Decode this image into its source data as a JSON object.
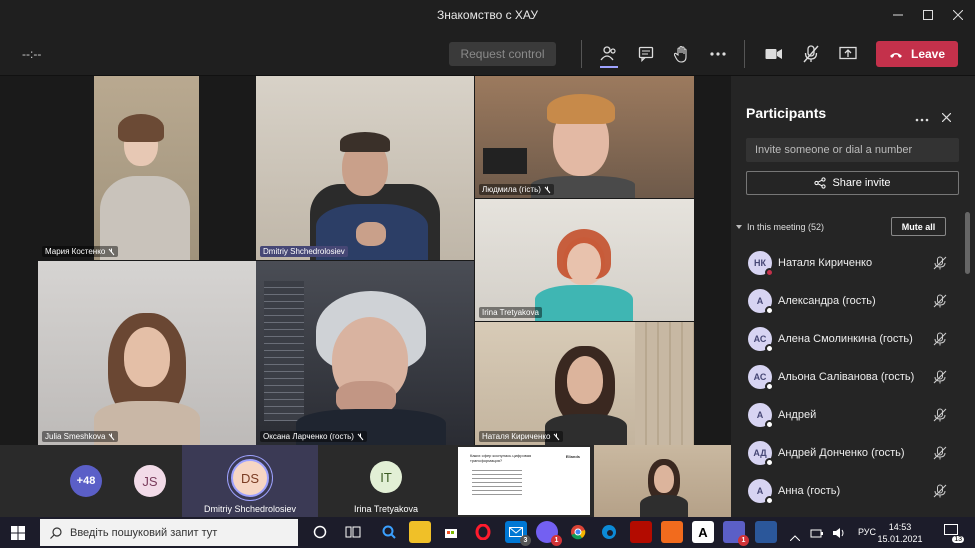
{
  "window": {
    "title": "Знакомство с ХАУ"
  },
  "toolbar": {
    "timer": "--:--",
    "request_control": "Request control",
    "leave_label": "Leave",
    "accent": "#c4314b"
  },
  "stage": {
    "tiles": [
      {
        "name": "Мария Костенко",
        "mic": "muted"
      },
      {
        "name": "Dmitriy Shchedrolosiev",
        "mic": "none"
      },
      {
        "name": "Людмила (гість)",
        "mic": "muted"
      },
      {
        "name": "Irina Tretyakova",
        "mic": "none"
      },
      {
        "name": "Julia Smeshkova",
        "mic": "muted"
      },
      {
        "name": "Оксана Ларченко (гость)",
        "mic": "muted"
      },
      {
        "name": "Наталя Кириченко",
        "mic": "muted"
      }
    ]
  },
  "strip": {
    "more_count": "+48",
    "items": [
      {
        "initials": "JS",
        "label": ""
      },
      {
        "initials": "DS",
        "label": "Dmitriy Shchedrolosiev"
      },
      {
        "initials": "IT",
        "label": "Irina Tretyakova"
      }
    ],
    "slide": {
      "title": "Каких сфер коснулась цифровая трансформация?",
      "brand": "Ellands"
    }
  },
  "participants": {
    "title": "Participants",
    "invite_placeholder": "Invite someone or dial a number",
    "share_invite": "Share invite",
    "in_meeting": "In this meeting (52)",
    "mute_all": "Mute all",
    "list": [
      {
        "initials": "НК",
        "name": "Наталя Кириченко",
        "status": "red"
      },
      {
        "initials": "А",
        "name": "Александра (гость)",
        "status": "white"
      },
      {
        "initials": "АС",
        "name": "Алена Смолинкина (гость)",
        "status": "white"
      },
      {
        "initials": "АС",
        "name": "Альона Саліванова (гость)",
        "status": "white"
      },
      {
        "initials": "А",
        "name": "Андрей",
        "status": "white"
      },
      {
        "initials": "АД",
        "name": "Андрей Донченко (гость)",
        "status": "white"
      },
      {
        "initials": "А",
        "name": "Анна (гость)",
        "status": "white"
      }
    ]
  },
  "taskbar": {
    "search_placeholder": "Введіть пошуковий запит тут",
    "mail_badge": "3",
    "viber_badge": "1",
    "teams_badge": "1",
    "notify_count": "13",
    "lang": "РУС",
    "time": "14:53",
    "date": "15.01.2021"
  }
}
